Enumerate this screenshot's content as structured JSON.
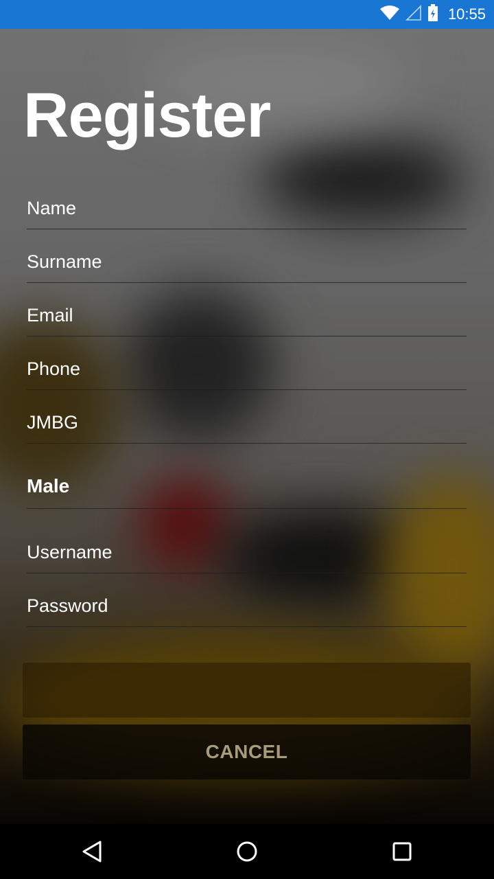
{
  "status_bar": {
    "time": "10:55",
    "icons": [
      "wifi-icon",
      "signal-icon",
      "battery-icon"
    ]
  },
  "form": {
    "title": "Register",
    "fields": [
      {
        "name": "name-field",
        "placeholder": "Name"
      },
      {
        "name": "surname-field",
        "placeholder": "Surname"
      },
      {
        "name": "email-field",
        "placeholder": "Email"
      },
      {
        "name": "phone-field",
        "placeholder": "Phone"
      },
      {
        "name": "jmbg-field",
        "placeholder": "JMBG"
      }
    ],
    "gender": {
      "selected": "Male"
    },
    "username_placeholder": "Username",
    "password_placeholder": "Password",
    "register_label": "",
    "cancel_label": "CANCEL"
  },
  "nav_bar": {
    "icons": [
      "back-icon",
      "home-icon",
      "recents-icon"
    ]
  },
  "colors": {
    "status_bar": "#1976d2",
    "text": "#ffffff",
    "cancel_text": "#a89c7c"
  }
}
